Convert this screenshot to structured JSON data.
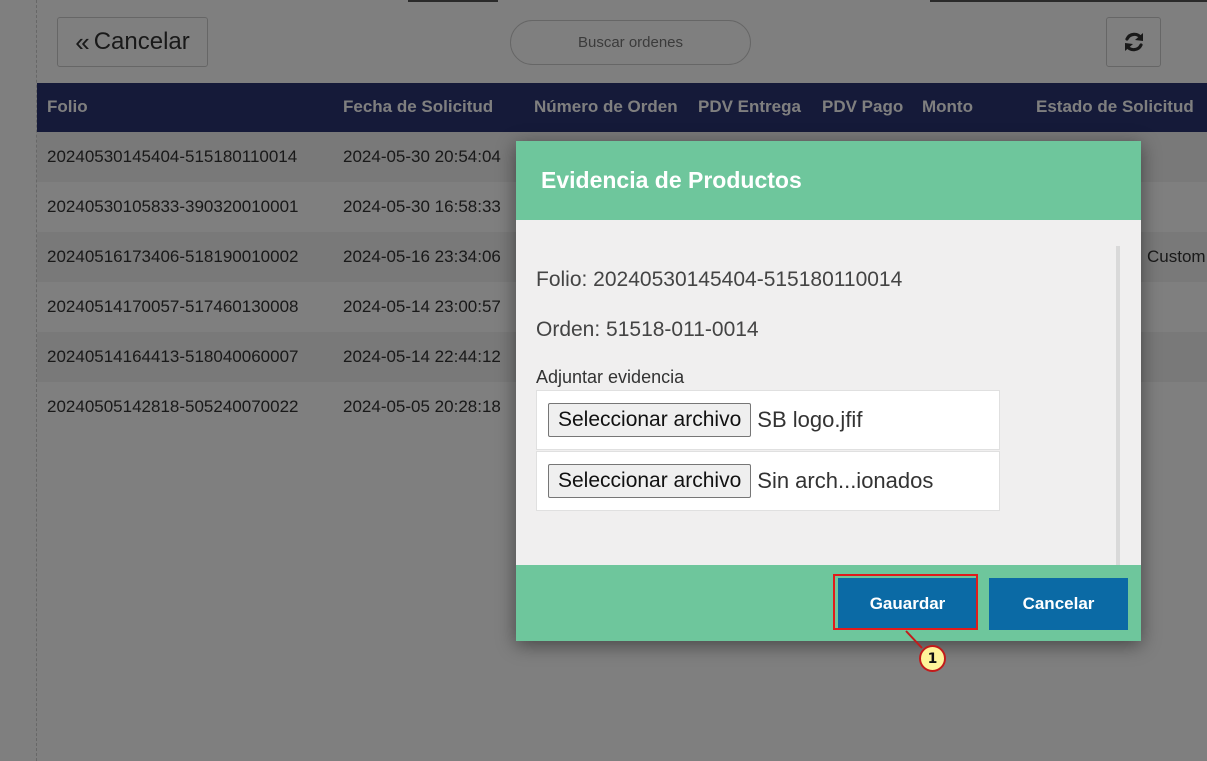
{
  "toolbar": {
    "back_label": "Cancelar",
    "search_placeholder": "Buscar ordenes",
    "refresh_icon": "refresh-icon"
  },
  "table": {
    "headers": [
      "Folio",
      "Fecha de Solicitud",
      "Número de Orden",
      "PDV Entrega",
      "PDV Pago",
      "Monto",
      "Estado de Solicitud"
    ],
    "rows": [
      {
        "folio": "20240530145404-515180110014",
        "fecha": "2024-05-30 20:54:04",
        "extra": ""
      },
      {
        "folio": "20240530105833-390320010001",
        "fecha": "2024-05-30 16:58:33",
        "extra": ""
      },
      {
        "folio": "20240516173406-518190010002",
        "fecha": "2024-05-16 23:34:06",
        "extra": "Custom"
      },
      {
        "folio": "20240514170057-517460130008",
        "fecha": "2024-05-14 23:00:57",
        "extra": ""
      },
      {
        "folio": "20240514164413-518040060007",
        "fecha": "2024-05-14 22:44:12",
        "extra": ""
      },
      {
        "folio": "20240505142818-505240070022",
        "fecha": "2024-05-05 20:28:18",
        "extra": ""
      }
    ]
  },
  "modal": {
    "title": "Evidencia de Productos",
    "folio": "Folio: 20240530145404-515180110014",
    "orden": "Orden: 51518-011-0014",
    "attach_label": "Adjuntar evidencia",
    "file_button_label": "Seleccionar archivo",
    "file1_name": "SB logo.jfif",
    "file2_name": "Sin arch...ionados",
    "save_label": "Gauardar",
    "cancel_label": "Cancelar"
  },
  "annotation": {
    "step": "1"
  },
  "colors": {
    "header_bg": "#2b3473",
    "modal_accent": "#6ec69c",
    "button_blue": "#0b6aa5",
    "highlight_red": "#e11b1b"
  }
}
